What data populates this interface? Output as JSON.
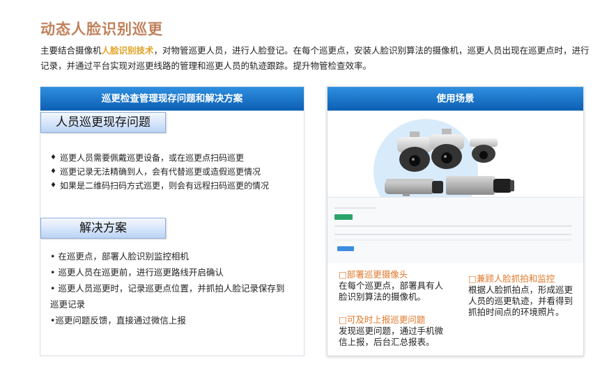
{
  "title": "动态人脸识别巡更",
  "intro": {
    "before": "主要结合摄像机",
    "highlight": "人脸识别技术",
    "after": "，对物管巡更人员，进行人脸登记。在每个巡更点，安装人脸识别算法的摄像机，巡更人员出现在巡更点时，进行记录，并通过平台实现对巡更线路的管理和巡更人员的轨迹跟踪。提升物管检查效率。"
  },
  "left_panel": {
    "header": "巡更检查管理现存问题和解决方案",
    "problem_tag": "人员巡更现存问题",
    "problems": [
      "巡更人员需要佩戴巡更设备，或在巡更点扫码巡更",
      "巡更记录无法精确到人，会有代替巡更或造假巡更情况",
      "如果是二维码扫码方式巡更，则会有远程扫码巡更的情况"
    ],
    "solution_tag": "解决方案",
    "solutions": [
      "• 在巡更点，部署人脸识别监控相机",
      "• 巡更人员在巡更前，进行巡更路线开启确认",
      "• 巡更人员巡更时，记录巡更点位置，并抓拍人脸记录保存到",
      "巡更记录",
      "•巡更问题反馈，直接通过微信上报"
    ],
    "bullet": "♦"
  },
  "right_panel": {
    "header": "使用场景",
    "features": [
      {
        "heading": "□部署巡更摄像头",
        "body": [
          "在每个巡更点，部署具有人",
          "脸识别算法的摄像机。"
        ]
      },
      {
        "heading": "□可及时上报巡更问题",
        "body": [
          "发现巡更问题，通过手机微",
          "信上报，后台汇总报表。"
        ]
      },
      {
        "heading": "□兼顾人脸抓拍和监控",
        "body": [
          "根据人脸抓拍点，形成巡更",
          "人员的巡更轨迹，并看得到",
          "抓拍时间点的环境照片。"
        ]
      }
    ]
  },
  "colors": {
    "title": "#c0805a",
    "highlight": "#e0a020",
    "header_top": "#2f8fe0",
    "header_bottom": "#0d5fb3",
    "feature_heading": "#e0782a"
  }
}
